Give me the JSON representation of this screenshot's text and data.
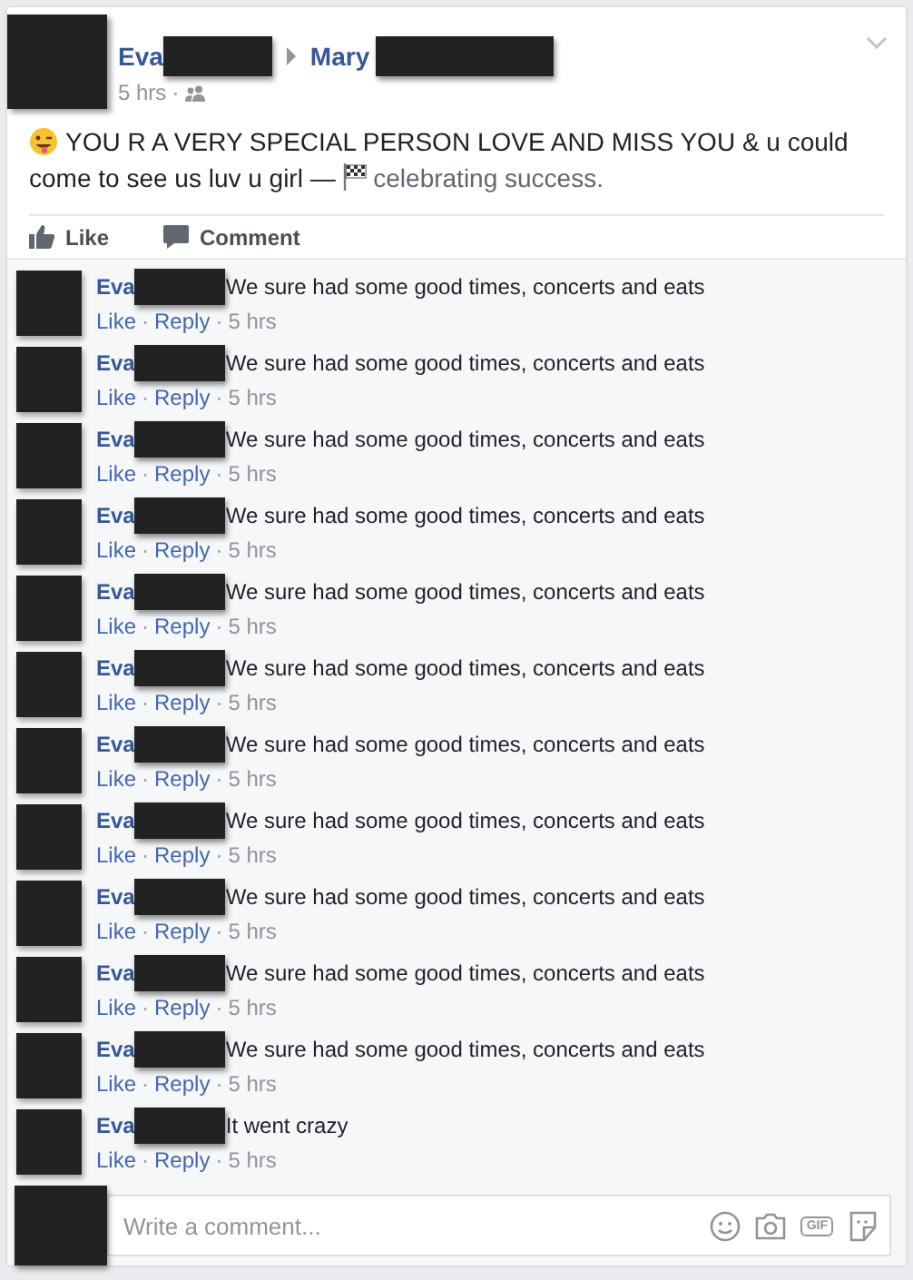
{
  "post": {
    "author": "Eva",
    "target": "Mary",
    "time": "5 hrs",
    "separator": "·",
    "text": "YOU R A VERY SPECIAL PERSON LOVE AND MISS YOU & u could come to see us luv u girl —",
    "activity": "celebrating success."
  },
  "actions": [
    {
      "kind": "like",
      "label": "Like"
    },
    {
      "kind": "comment",
      "label": "Comment"
    }
  ],
  "comments": [
    {
      "author": "Eva",
      "text": "We sure had some good times, concerts and eats",
      "like": "Like",
      "separator_1": "·",
      "reply": "Reply",
      "separator_2": "·",
      "time": "5 hrs"
    },
    {
      "author": "Eva",
      "text": "We sure had some good times, concerts and eats",
      "like": "Like",
      "separator_1": "·",
      "reply": "Reply",
      "separator_2": "·",
      "time": "5 hrs"
    },
    {
      "author": "Eva",
      "text": "We sure had some good times, concerts and eats",
      "like": "Like",
      "separator_1": "·",
      "reply": "Reply",
      "separator_2": "·",
      "time": "5 hrs"
    },
    {
      "author": "Eva",
      "text": "We sure had some good times, concerts and eats",
      "like": "Like",
      "separator_1": "·",
      "reply": "Reply",
      "separator_2": "·",
      "time": "5 hrs"
    },
    {
      "author": "Eva",
      "text": "We sure had some good times, concerts and eats",
      "like": "Like",
      "separator_1": "·",
      "reply": "Reply",
      "separator_2": "·",
      "time": "5 hrs"
    },
    {
      "author": "Eva",
      "text": "We sure had some good times, concerts and eats",
      "like": "Like",
      "separator_1": "·",
      "reply": "Reply",
      "separator_2": "·",
      "time": "5 hrs"
    },
    {
      "author": "Eva",
      "text": "We sure had some good times, concerts and eats",
      "like": "Like",
      "separator_1": "·",
      "reply": "Reply",
      "separator_2": "·",
      "time": "5 hrs"
    },
    {
      "author": "Eva",
      "text": "We sure had some good times, concerts and eats",
      "like": "Like",
      "separator_1": "·",
      "reply": "Reply",
      "separator_2": "·",
      "time": "5 hrs"
    },
    {
      "author": "Eva",
      "text": "We sure had some good times, concerts and eats",
      "like": "Like",
      "separator_1": "·",
      "reply": "Reply",
      "separator_2": "·",
      "time": "5 hrs"
    },
    {
      "author": "Eva",
      "text": "We sure had some good times, concerts and eats",
      "like": "Like",
      "separator_1": "·",
      "reply": "Reply",
      "separator_2": "·",
      "time": "5 hrs"
    },
    {
      "author": "Eva",
      "text": "We sure had some good times, concerts and eats",
      "like": "Like",
      "separator_1": "·",
      "reply": "Reply",
      "separator_2": "·",
      "time": "5 hrs"
    },
    {
      "author": "Eva",
      "text": "It went crazy",
      "like": "Like",
      "separator_1": "·",
      "reply": "Reply",
      "separator_2": "·",
      "time": "5 hrs"
    }
  ],
  "composer": {
    "placeholder": "Write a comment...",
    "gif_label": "GIF"
  }
}
